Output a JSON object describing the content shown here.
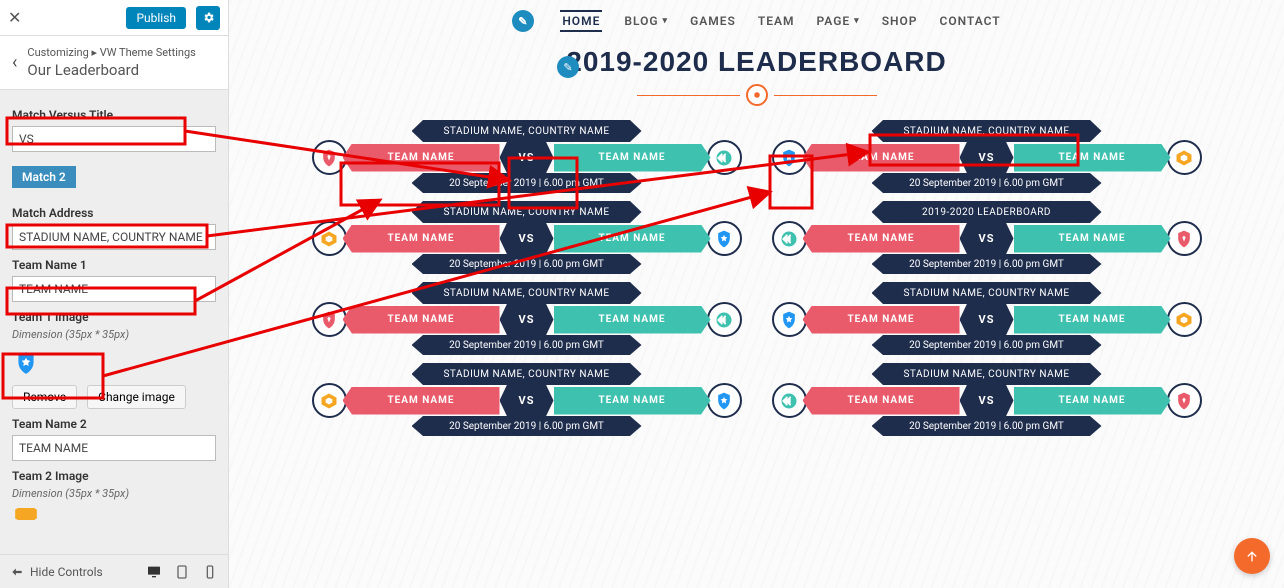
{
  "sidebar": {
    "publish": "Publish",
    "crumb": "Customizing ▸ VW Theme Settings",
    "title": "Our Leaderboard",
    "fields": {
      "versus_label": "Match Versus Title",
      "versus_value": "VS",
      "match_button": "Match 2",
      "address_label": "Match Address",
      "address_value": "STADIUM NAME, COUNTRY NAME",
      "team1_label": "Team Name 1",
      "team1_value": "TEAM NAME",
      "img1_label": "Team 1 Image",
      "img_dim": "Dimension (35px * 35px)",
      "remove": "Remove",
      "change": "Change image",
      "team2_label": "Team Name 2",
      "team2_value": "TEAM NAME",
      "img2_label": "Team 2 Image"
    },
    "hide": "Hide Controls"
  },
  "nav": {
    "items": [
      "Home",
      "Blog",
      "Games",
      "Team",
      "Page",
      "Shop",
      "Contact"
    ],
    "dropdowns": [
      1,
      4
    ]
  },
  "page": {
    "title": "2019-2020 LEADERBOARD",
    "alt_title": "2019-2020 LEADERBOARD"
  },
  "match": {
    "stadium": "STADIUM NAME, COUNTRY NAME",
    "team": "TEAM NAME",
    "vs": "VS",
    "date": "20 September 2019 | 6.00 pm GMT"
  },
  "badges": {
    "shield_red": "#e95a6a",
    "hex_teal": "#3fc1b0",
    "hex_orange": "#f5a623",
    "star_blue": "#2196f3",
    "chev_teal": "#3fc1b0"
  },
  "layout": [
    [
      "shield_red",
      "chev_teal",
      "star_blue",
      "hex_orange"
    ],
    [
      "hex_orange",
      "star_blue",
      "chev_teal",
      "shield_red"
    ],
    [
      "shield_red",
      "chev_teal",
      "star_blue",
      "hex_orange"
    ],
    [
      "hex_orange",
      "star_blue",
      "chev_teal",
      "shield_red"
    ]
  ],
  "row1_right_title_override": true
}
